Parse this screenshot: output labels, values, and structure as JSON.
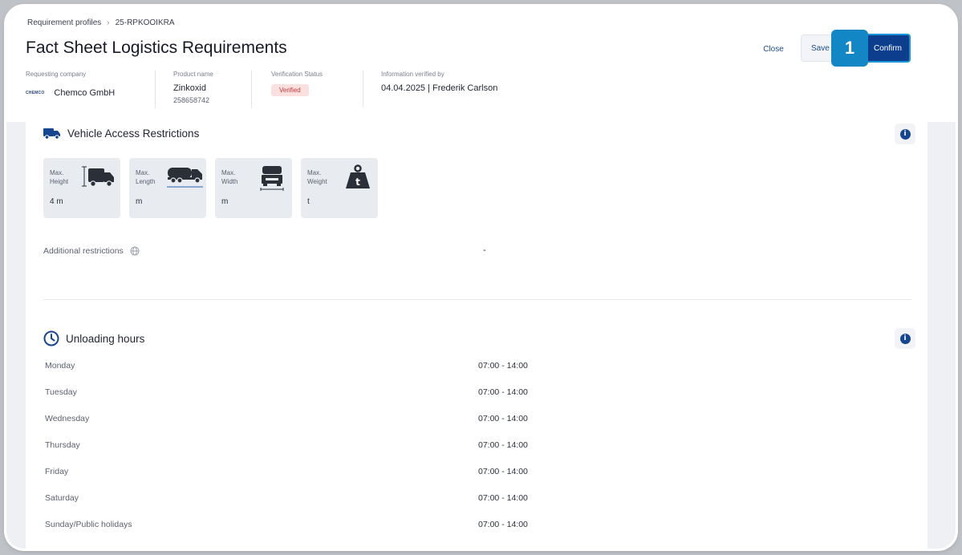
{
  "breadcrumb": {
    "parent": "Requirement profiles",
    "current": "25-RPKOOIKRA"
  },
  "page_title": "Fact Sheet Logistics Requirements",
  "actions": {
    "close_label": "Close",
    "save_label": "Save d",
    "confirm_label": "Confirm",
    "step_number": "1"
  },
  "meta": {
    "requesting_company_label": "Requesting company",
    "company_logo_text": "CHEMCO",
    "company_name": "Chemco GmbH",
    "product_name_label": "Product name",
    "product_name": "Zinkoxid",
    "product_number": "258658742",
    "verification_status_label": "Verification Status",
    "verification_status": "Verified",
    "verified_by_label": "Information verified by",
    "verified_by": "04.04.2025 | Frederik Carlson"
  },
  "vehicle_section": {
    "title": "Vehicle Access Restrictions",
    "tiles": [
      {
        "label_line1": "Max.",
        "label_line2": "Height",
        "value": "4 m",
        "icon": "truck-height-icon"
      },
      {
        "label_line1": "Max.",
        "label_line2": "Length",
        "value": "m",
        "icon": "truck-length-icon"
      },
      {
        "label_line1": "Max.",
        "label_line2": "Width",
        "value": "m",
        "icon": "truck-width-icon"
      },
      {
        "label_line1": "Max.",
        "label_line2": "Weight",
        "value": "t",
        "icon": "weight-icon"
      }
    ],
    "weight_glyph": "t",
    "additional_restrictions_label": "Additional restrictions",
    "additional_restrictions_value": "-"
  },
  "unloading_section": {
    "title": "Unloading hours",
    "rows": [
      {
        "day": "Monday",
        "time": "07:00 - 14:00"
      },
      {
        "day": "Tuesday",
        "time": "07:00 - 14:00"
      },
      {
        "day": "Wednesday",
        "time": "07:00 - 14:00"
      },
      {
        "day": "Thursday",
        "time": "07:00 - 14:00"
      },
      {
        "day": "Friday",
        "time": "07:00 - 14:00"
      },
      {
        "day": "Saturday",
        "time": "07:00 - 14:00"
      },
      {
        "day": "Sunday/Public holidays",
        "time": "07:00 - 14:00"
      }
    ]
  },
  "info_glyph": "i",
  "colors": {
    "primary": "#0d3e8d",
    "accent": "#1387c5",
    "verified_bg": "#fbe0e0",
    "verified_text": "#c0393b"
  }
}
